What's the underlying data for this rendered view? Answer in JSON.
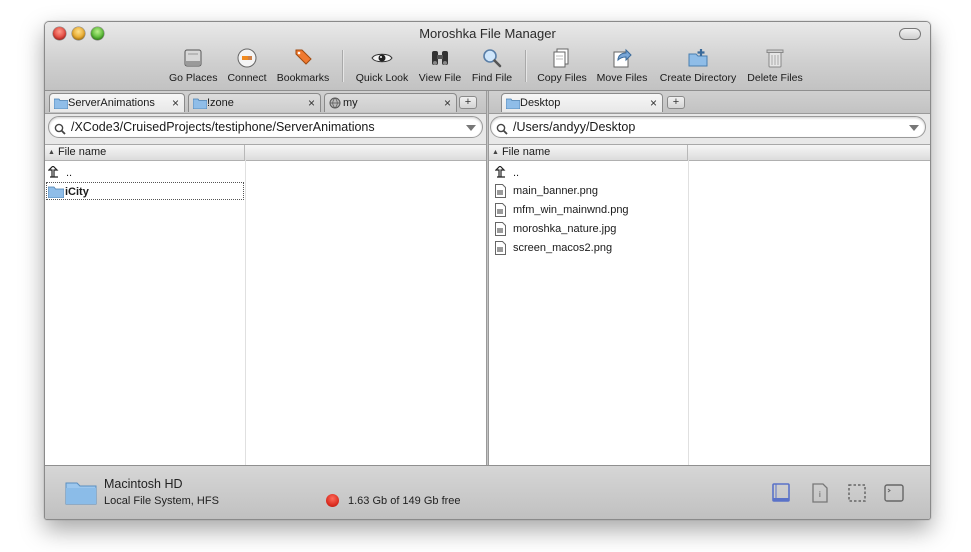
{
  "window": {
    "title": "Moroshka File Manager"
  },
  "toolbar": {
    "items": [
      {
        "label": "Go Places",
        "icon": "hard-drive-icon"
      },
      {
        "label": "Connect",
        "icon": "connect-plug-icon"
      },
      {
        "label": "Bookmarks",
        "icon": "bookmark-icon"
      },
      {
        "label": "Quick Look",
        "icon": "eye-icon"
      },
      {
        "label": "View File",
        "icon": "binoculars-icon"
      },
      {
        "label": "Find File",
        "icon": "magnifier-icon"
      },
      {
        "label": "Copy Files",
        "icon": "copy-documents-icon"
      },
      {
        "label": "Move Files",
        "icon": "move-arrow-icon"
      },
      {
        "label": "Create Directory",
        "icon": "new-folder-icon"
      },
      {
        "label": "Delete Files",
        "icon": "trash-icon"
      }
    ]
  },
  "left_panel": {
    "tabs": [
      {
        "label": "ServerAnimations",
        "icon": "folder-icon",
        "active": true
      },
      {
        "label": "!zone",
        "icon": "folder-icon",
        "active": false
      },
      {
        "label": "my",
        "icon": "network-globe-icon",
        "active": false
      }
    ],
    "path": "/XCode3/CruisedProjects/testiphone/ServerAnimations",
    "column_header": "File name",
    "rows": [
      {
        "name": "..",
        "icon": "parent-directory-icon"
      },
      {
        "name": "iCity",
        "icon": "folder-icon",
        "selected": true
      }
    ]
  },
  "right_panel": {
    "tabs": [
      {
        "label": "Desktop",
        "icon": "folder-icon",
        "active": true
      }
    ],
    "path": "/Users/andyy/Desktop",
    "column_header": "File name",
    "rows": [
      {
        "name": "..",
        "icon": "parent-directory-icon"
      },
      {
        "name": "main_banner.png",
        "icon": "image-file-icon"
      },
      {
        "name": "mfm_win_mainwnd.png",
        "icon": "image-file-icon"
      },
      {
        "name": "moroshka_nature.jpg",
        "icon": "image-file-icon"
      },
      {
        "name": "screen_macos2.png",
        "icon": "image-file-icon"
      }
    ]
  },
  "status": {
    "drive_name": "Macintosh HD",
    "drive_fs": "Local File System, HFS",
    "free_space": "1.63 Gb of 149 Gb free",
    "free_indicator_color": "#d82a1e"
  },
  "colors": {
    "accent_blue": "#5a72c8",
    "folder": "#8fbde8"
  }
}
